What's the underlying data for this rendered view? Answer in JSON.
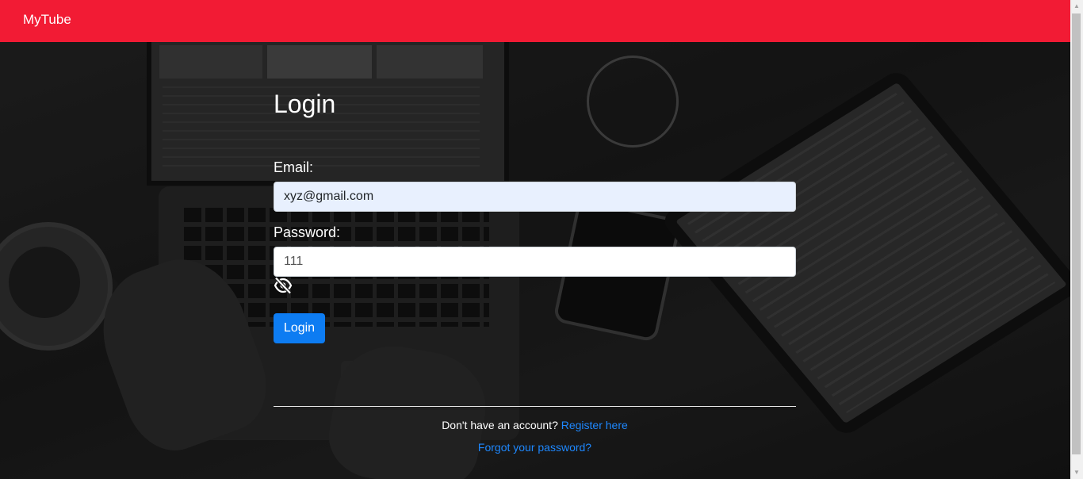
{
  "navbar": {
    "brand": "MyTube",
    "color": "#f21b34"
  },
  "login": {
    "title": "Login",
    "email_label": "Email:",
    "email_value": "xyz@gmail.com",
    "password_label": "Password:",
    "password_value": "111",
    "toggle_icon": "eye-slash-icon",
    "submit_label": "Login",
    "button_color": "#0d7cf2"
  },
  "footer": {
    "register_prompt": "Don't have an account?",
    "register_link": "Register here",
    "forgot_link": "Forgot your password?",
    "link_color": "#1e88ff"
  }
}
